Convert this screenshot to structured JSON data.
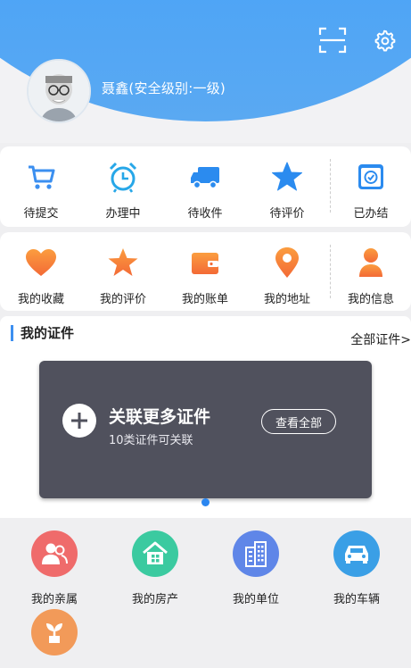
{
  "user": {
    "name": "聂鑫(安全级别:一级)"
  },
  "orders": [
    {
      "label": "待提交",
      "icon": "cart-icon"
    },
    {
      "label": "办理中",
      "icon": "alarm-clock-icon"
    },
    {
      "label": "待收件",
      "icon": "truck-icon"
    },
    {
      "label": "待评价",
      "icon": "star-icon"
    },
    {
      "label": "已办结",
      "icon": "done-icon"
    }
  ],
  "personal": [
    {
      "label": "我的收藏",
      "icon": "heart-icon"
    },
    {
      "label": "我的评价",
      "icon": "star-icon"
    },
    {
      "label": "我的账单",
      "icon": "wallet-icon"
    },
    {
      "label": "我的地址",
      "icon": "location-pin-icon"
    },
    {
      "label": "我的信息",
      "icon": "person-icon"
    }
  ],
  "certs": {
    "title": "我的证件",
    "all_link": "全部证件>",
    "card_main": "关联更多证件",
    "card_sub": "10类证件可关联",
    "view_all": "查看全部"
  },
  "bottom": [
    {
      "label": "我的亲属",
      "icon": "family-icon",
      "color": "#ef6b6b"
    },
    {
      "label": "我的房产",
      "icon": "house-icon",
      "color": "#3bcaa0"
    },
    {
      "label": "我的单位",
      "icon": "building-icon",
      "color": "#5f86e8"
    },
    {
      "label": "我的车辆",
      "icon": "car-icon",
      "color": "#3a9fe6"
    },
    {
      "label": "",
      "icon": "plant-icon",
      "color": "#f29a59"
    }
  ],
  "colors": {
    "header": "#36a0f8",
    "accent": "#3d8ff0",
    "card": "#50515d"
  }
}
